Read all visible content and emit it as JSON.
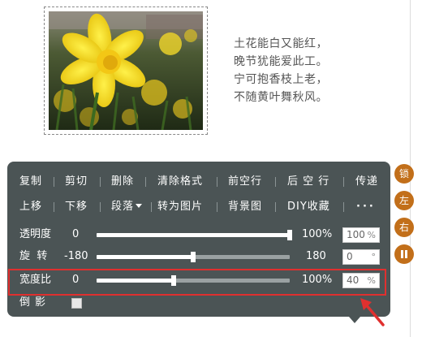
{
  "poem": {
    "lines": [
      "土花能白又能红，",
      "晚节犹能爱此工。",
      "宁可抱香枝上老，",
      "不随黄叶舞秋风。"
    ]
  },
  "image": {
    "alt": "yellow daffodil photo"
  },
  "toolbar": {
    "row1": [
      "复制",
      "剪切",
      "删除",
      "清除格式",
      "前空行",
      "后 空 行",
      "传递"
    ],
    "row2": [
      "上移",
      "下移",
      "段落",
      "转为图片",
      "背景图",
      "DIY收藏",
      "···"
    ]
  },
  "sliders": {
    "opacity": {
      "label": "透明度",
      "min": "0",
      "max": "100%",
      "value": "100",
      "unit": "%",
      "level": 1.0
    },
    "rotate": {
      "label": "旋  转",
      "min": "-180",
      "max": "180",
      "value": "0",
      "unit": "°",
      "level": 0.5
    },
    "width_ratio": {
      "label": "宽度比",
      "min": "0",
      "max": "100%",
      "value": "40",
      "unit": "%",
      "level": 0.4
    }
  },
  "shadow": {
    "label": "倒影",
    "checked": false
  },
  "side": {
    "buttons": [
      "锁",
      "左",
      "右",
      "⏸"
    ]
  },
  "colors": {
    "panel": "#4b5455",
    "side_button": "#c26f1a",
    "highlight": "#e0302f"
  }
}
